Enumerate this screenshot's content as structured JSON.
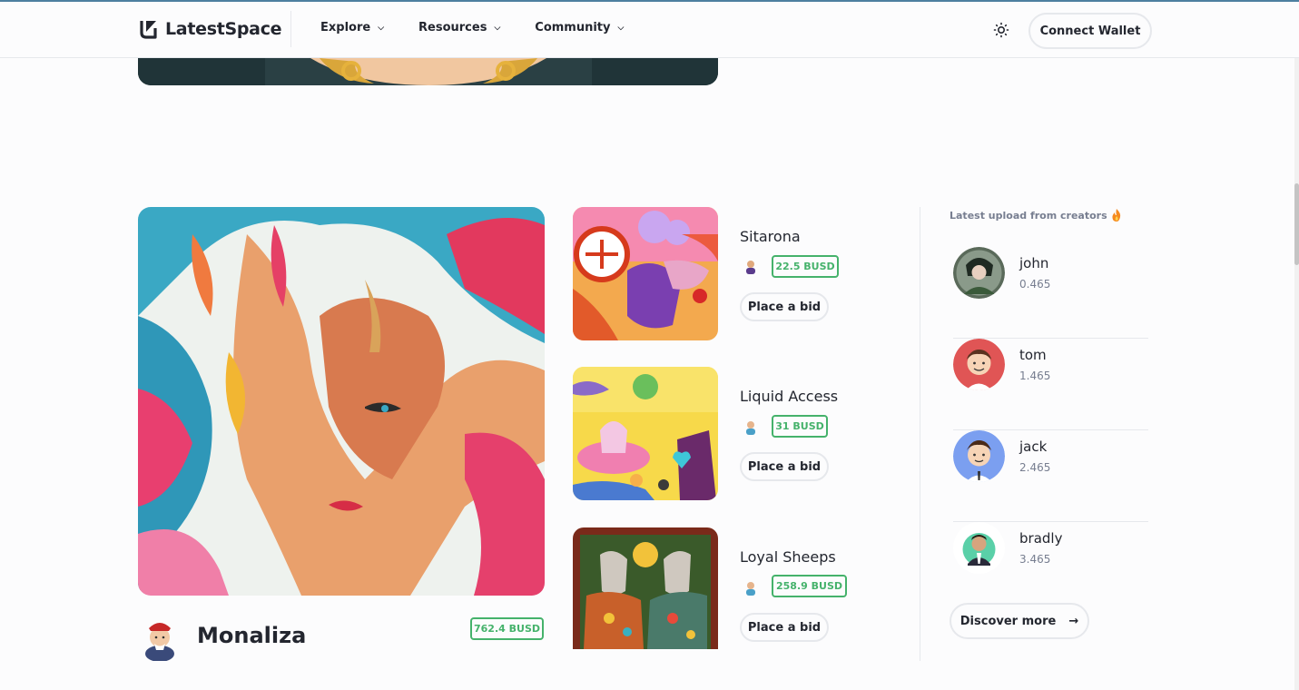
{
  "header": {
    "brand": "LatestSpace",
    "nav": [
      {
        "label": "Explore"
      },
      {
        "label": "Resources"
      },
      {
        "label": "Community"
      }
    ],
    "connect_wallet_label": "Connect Wallet",
    "theme_icon": "sun-icon"
  },
  "featured": {
    "title": "Monaliza",
    "price": "762.4 BUSD"
  },
  "items": [
    {
      "title": "Sitarona",
      "price": "22.5 BUSD",
      "bid_label": "Place a bid"
    },
    {
      "title": "Liquid Access",
      "price": "31 BUSD",
      "bid_label": "Place a bid"
    },
    {
      "title": "Loyal Sheeps",
      "price": "258.9 BUSD",
      "bid_label": "Place a bid"
    }
  ],
  "sidebar": {
    "heading": "Latest upload from creators",
    "heading_icon": "fire-icon",
    "creators": [
      {
        "name": "john",
        "value": "0.465"
      },
      {
        "name": "tom",
        "value": "1.465"
      },
      {
        "name": "jack",
        "value": "2.465"
      },
      {
        "name": "bradly",
        "value": "3.465"
      }
    ],
    "discover_label": "Discover more",
    "discover_icon": "arrow-right-icon"
  },
  "colors": {
    "accent_green": "#45b26b",
    "text_dark": "#23262f",
    "text_muted": "#777e90",
    "border": "#e6e8ec"
  }
}
